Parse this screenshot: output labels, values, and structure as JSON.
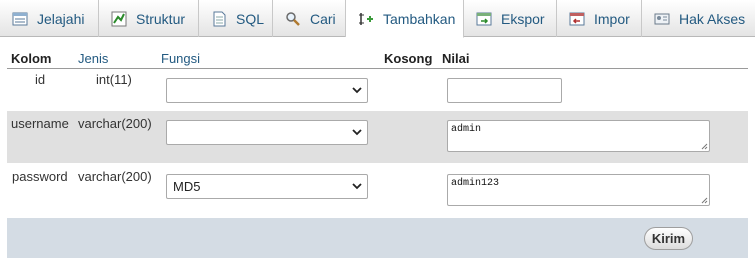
{
  "tabs": [
    {
      "label": "Jelajahi",
      "icon": "browse-icon"
    },
    {
      "label": "Struktur",
      "icon": "structure-icon"
    },
    {
      "label": "SQL",
      "icon": "sql-icon"
    },
    {
      "label": "Cari",
      "icon": "search-icon"
    },
    {
      "label": "Tambahkan",
      "icon": "insert-icon",
      "active": true
    },
    {
      "label": "Ekspor",
      "icon": "export-icon"
    },
    {
      "label": "Impor",
      "icon": "import-icon"
    },
    {
      "label": "Hak Akses",
      "icon": "privileges-icon"
    }
  ],
  "table": {
    "headers": {
      "column": "Kolom",
      "type": "Jenis",
      "function": "Fungsi",
      "null": "Kosong",
      "value": "Nilai"
    },
    "rows": [
      {
        "column": "id",
        "type": "int(11)",
        "function": "",
        "value": ""
      },
      {
        "column": "username",
        "type": "varchar(200)",
        "function": "",
        "value": "admin"
      },
      {
        "column": "password",
        "type": "varchar(200)",
        "function": "MD5",
        "value": "admin123"
      }
    ]
  },
  "footer": {
    "submit_label": "Kirim"
  },
  "colors": {
    "link": "#235a81",
    "row_alt": "#e0e0e0",
    "footer_bg": "#d4dce4"
  }
}
